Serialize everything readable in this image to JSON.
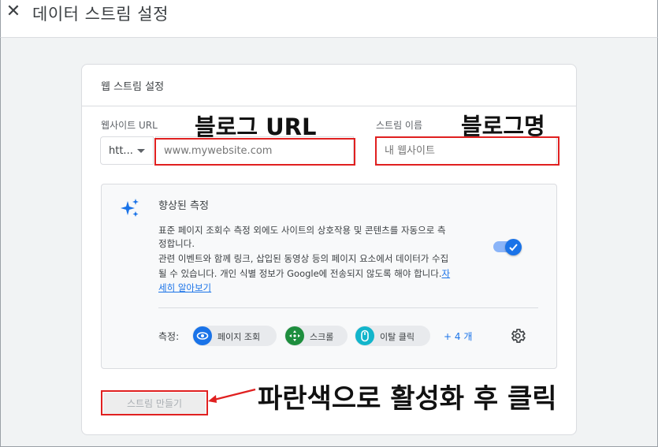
{
  "header": {
    "close_icon": "close-icon",
    "title": "데이터 스트림 설정"
  },
  "card": {
    "title": "웹 스트림 설정",
    "website_url": {
      "label": "웹사이트 URL",
      "protocol_value": "htt...",
      "placeholder": "www.mywebsite.com"
    },
    "stream_name": {
      "label": "스트림 이름",
      "placeholder": "내 웹사이트"
    },
    "enhanced_measurement": {
      "icon": "sparkle-icon",
      "title": "향상된 측정",
      "desc_line1": "표준 페이지 조회수 측정 외에도 사이트의 상호작용 및 콘텐츠를 자동으로 측",
      "desc_line2": "정합니다.",
      "desc_line3": "관련 이벤트와 함께 링크, 삽입된 동영상 등의 페이지 요소에서 데이터가 수집",
      "desc_line4": "될 수 있습니다. 개인 식별 정보가 Google에 전송되지 않도록 해야 합니다.",
      "learn_more_part1": "자",
      "learn_more_part2": "세히 알아보기",
      "toggle_on": true,
      "measure_label": "측정:",
      "chips": [
        {
          "label": "페이지 조회",
          "icon": "eye-icon",
          "color": "#1a73e8"
        },
        {
          "label": "스크롤",
          "icon": "crosshair-icon",
          "color": "#1e8e3e"
        },
        {
          "label": "이탈 클릭",
          "icon": "mouse-icon",
          "color": "#12b5cb"
        }
      ],
      "more_link": "+ 4 개",
      "settings_icon": "gear-icon"
    },
    "create_button": "스트림 만들기"
  },
  "annotations": {
    "url_note": "블로그 URL",
    "name_note": "블로그명",
    "button_note": "파란색으로 활성화 후 클릭",
    "highlight_color": "#e02020"
  },
  "colors": {
    "accent": "#1a73e8",
    "background": "#f1f3f4"
  }
}
